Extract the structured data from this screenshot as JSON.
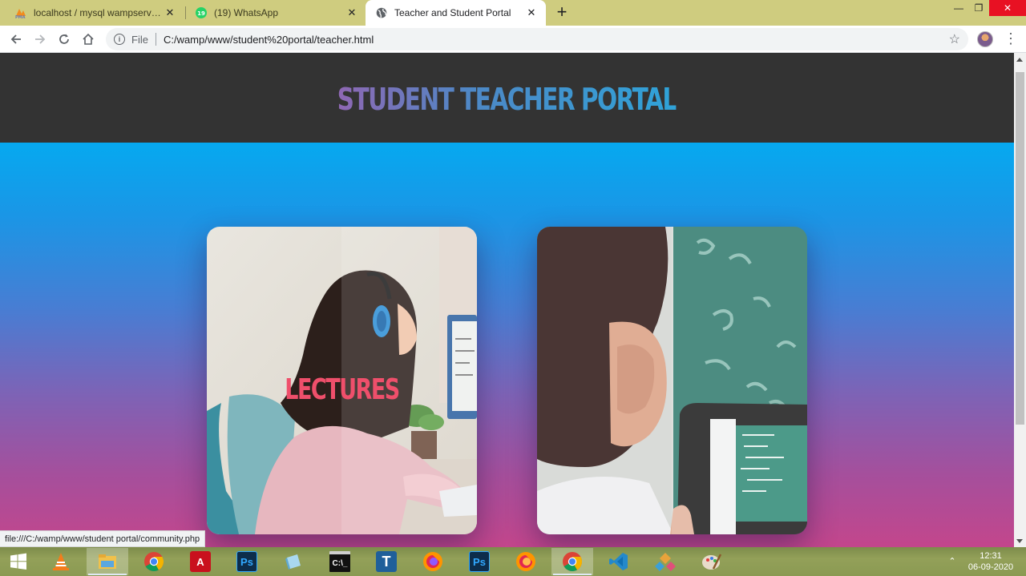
{
  "browser": {
    "tabs": [
      {
        "title": "localhost / mysql wampserver / s",
        "icon": "phpmyadmin-icon",
        "active": false
      },
      {
        "title": "(19) WhatsApp",
        "icon": "whatsapp-icon",
        "active": false
      },
      {
        "title": "Teacher and Student Portal",
        "icon": "globe-icon",
        "active": true
      }
    ],
    "new_tab": "+",
    "close_glyph": "✕",
    "window_controls": {
      "minimize": "—",
      "restore": "❐",
      "close": "✕"
    },
    "address": {
      "scheme_label": "File",
      "url": "C:/wamp/www/student%20portal/teacher.html"
    },
    "status_url": "file:///C:/wamp/www/student portal/community.php"
  },
  "page": {
    "title": "Student Teacher Portal",
    "cards": [
      {
        "label": "LECTURES",
        "image": "student-with-headphones-at-laptop"
      },
      {
        "label": "",
        "image": "student-with-tablet-at-chalkboard"
      }
    ],
    "colors": {
      "header_bg": "#333333",
      "gradient_top": "#06a9f0",
      "gradient_bottom": "#c3468c",
      "card_label": "#ef4f6b"
    }
  },
  "taskbar": {
    "apps": [
      "start-icon",
      "vlc-icon",
      "file-explorer-icon",
      "chrome-icon",
      "acrobat-icon",
      "photoshop-icon",
      "notepad-icon",
      "cmd-icon",
      "typing-master-icon",
      "firefox-icon",
      "photoshop-icon",
      "firefox-icon",
      "chrome-icon",
      "vscode-icon",
      "app-icon",
      "paint-icon"
    ],
    "time": "12:31",
    "date": "06-09-2020"
  }
}
